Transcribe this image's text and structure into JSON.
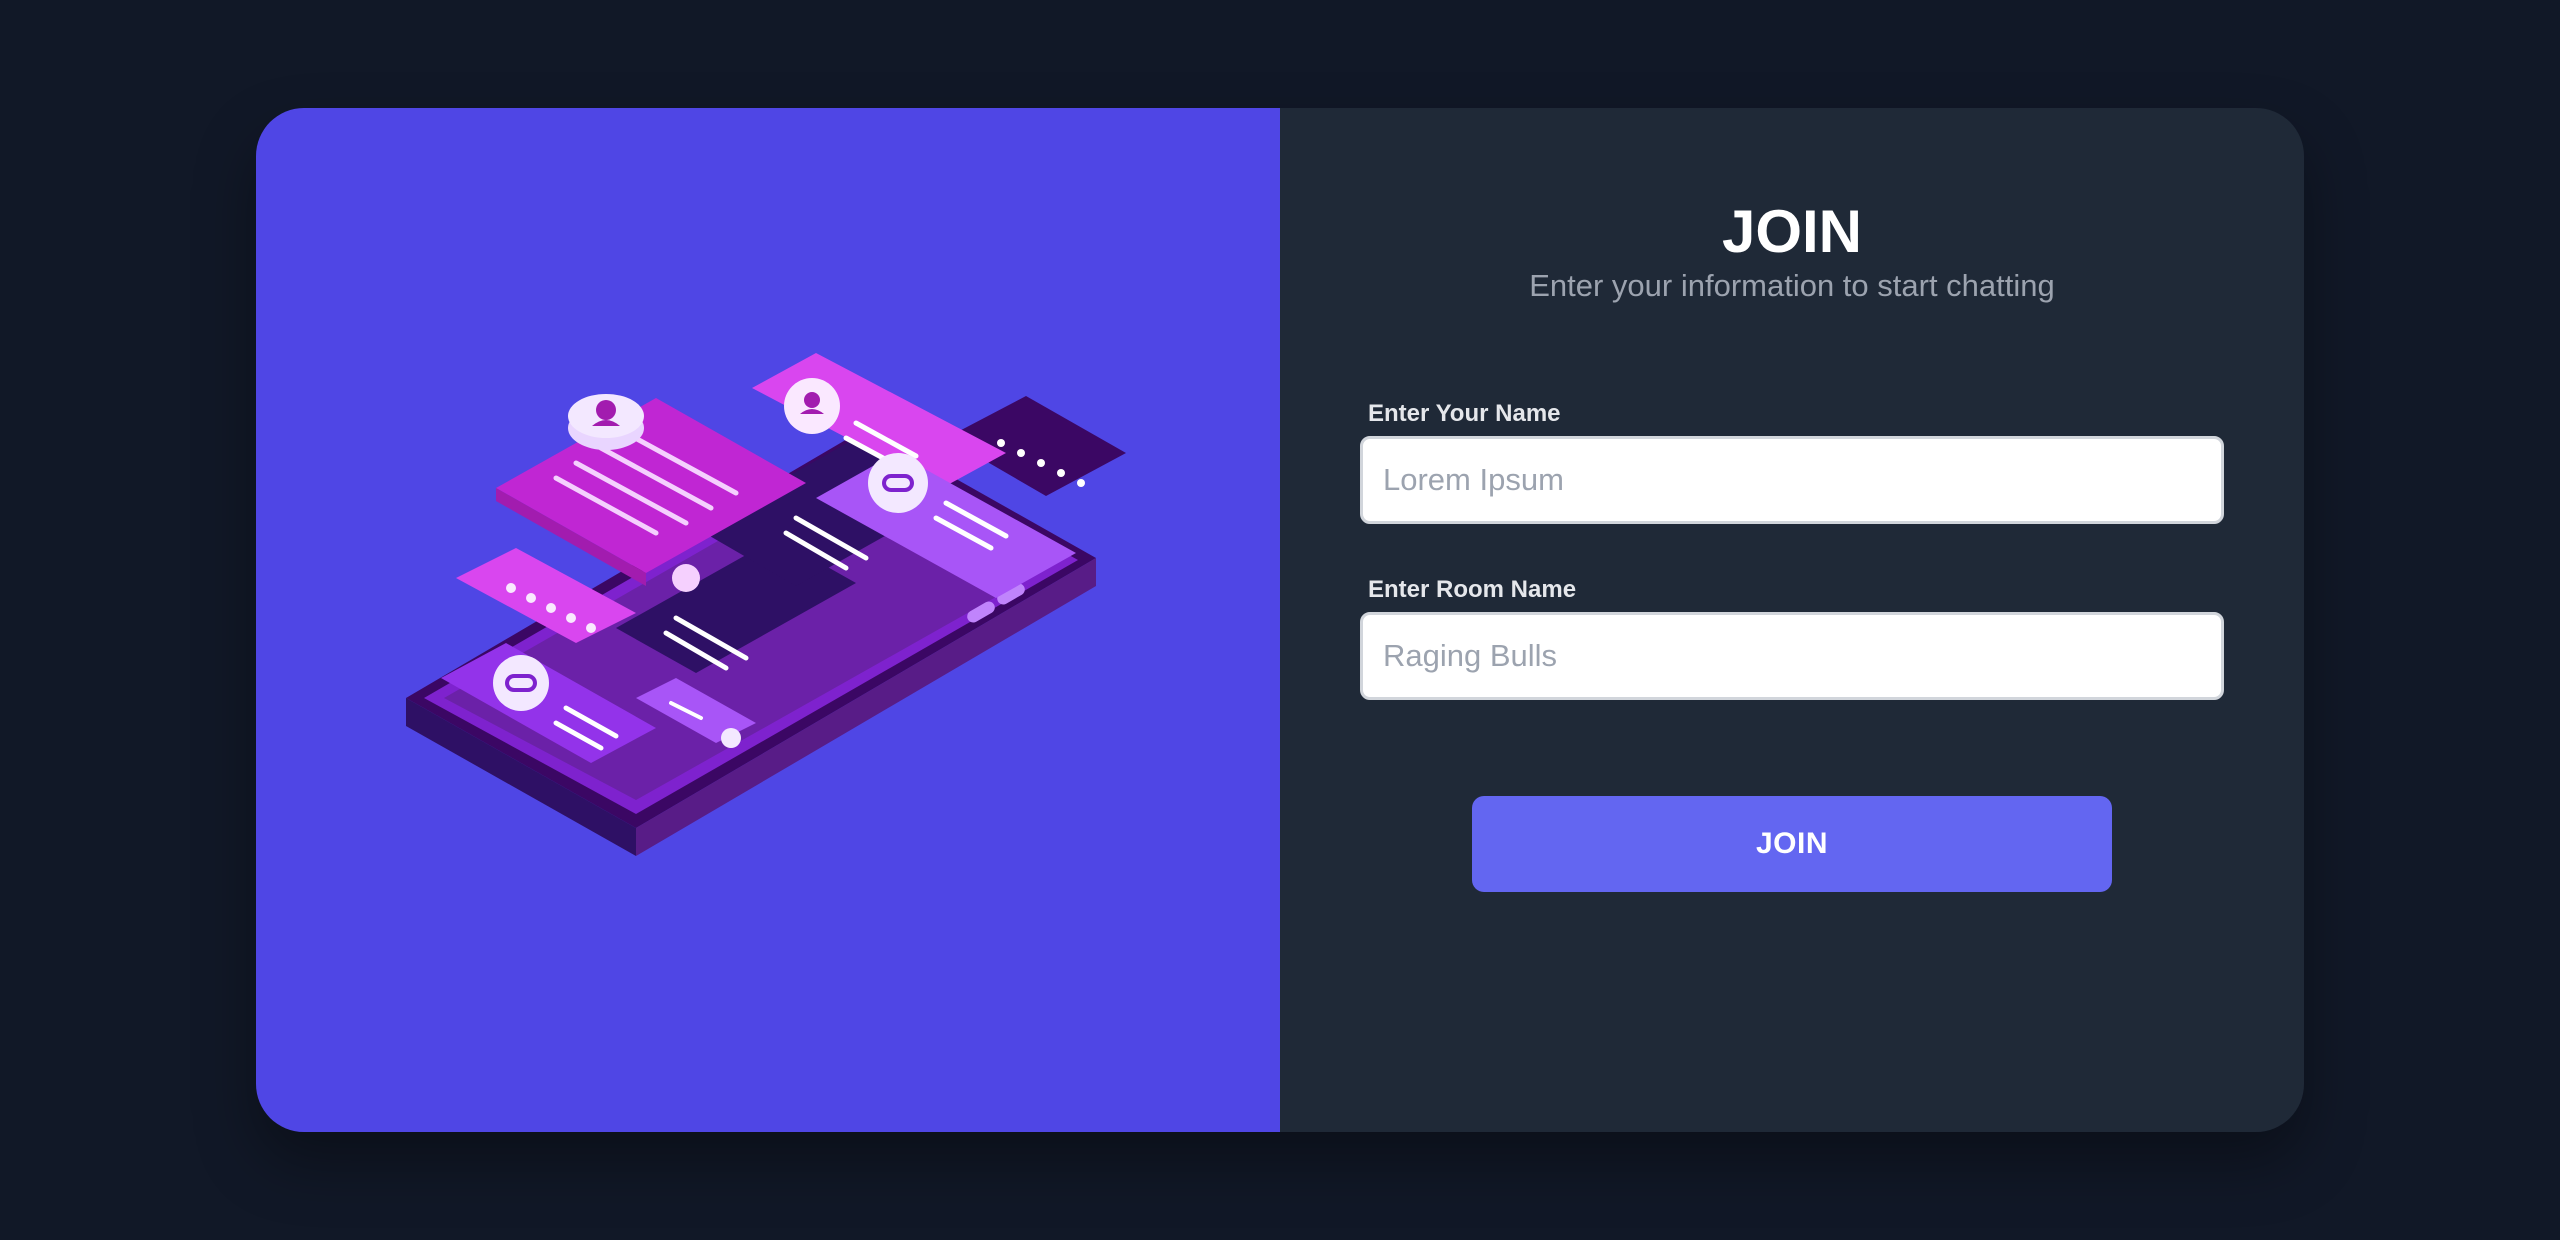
{
  "form": {
    "title": "JOIN",
    "subtitle": "Enter your information to start chatting",
    "name_label": "Enter Your Name",
    "name_placeholder": "Lorem Ipsum",
    "name_value": "",
    "room_label": "Enter Room Name",
    "room_placeholder": "Raging Bulls",
    "room_value": "",
    "submit_label": "JOIN"
  },
  "illustration": {
    "name": "isometric-phone-chat-illustration",
    "colors": {
      "panel_background": "#4f46e5",
      "phone_body": "#3b0764",
      "magenta_bubble": "#c026d3",
      "violet_bubble": "#9333ea",
      "dark_bubble": "#2e1065"
    }
  },
  "colors": {
    "page_background": "#111827",
    "form_background": "#1f2937",
    "accent": "#6366f1",
    "title": "#ffffff",
    "subtitle": "#9ca3af"
  }
}
